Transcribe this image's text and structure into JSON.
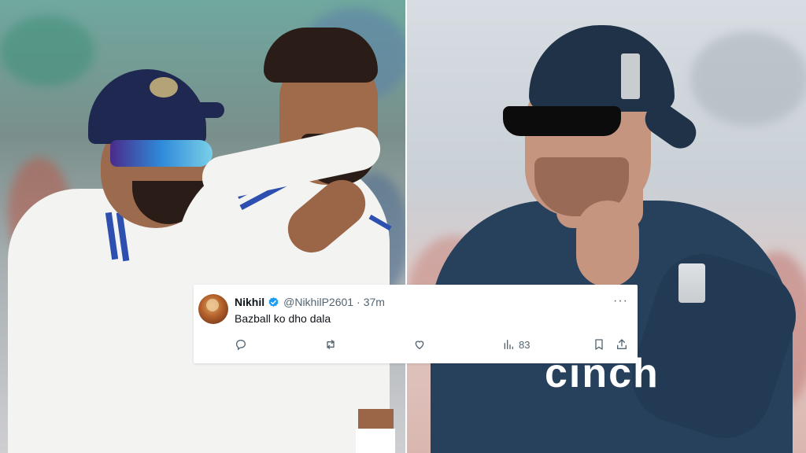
{
  "tweet": {
    "display_name": "Nikhil",
    "handle": "@NikhilP2601",
    "separator": "·",
    "time": "37m",
    "text": "Bazball ko dho dala",
    "more_label": "···",
    "views_count": "83",
    "verified_color": "#1d9bf0"
  },
  "photo_right": {
    "sponsor_text": "cinch"
  },
  "icons": [
    "reply-icon",
    "retweet-icon",
    "like-icon",
    "views-icon",
    "bookmark-icon",
    "share-icon",
    "verified-badge-icon",
    "more-icon"
  ],
  "colors": {
    "india_cap": "#1e2850",
    "india_stripe": "#2c4fb0",
    "england_navy": "#27415c",
    "tweet_text": "#0f1419",
    "tweet_meta": "#536471"
  }
}
